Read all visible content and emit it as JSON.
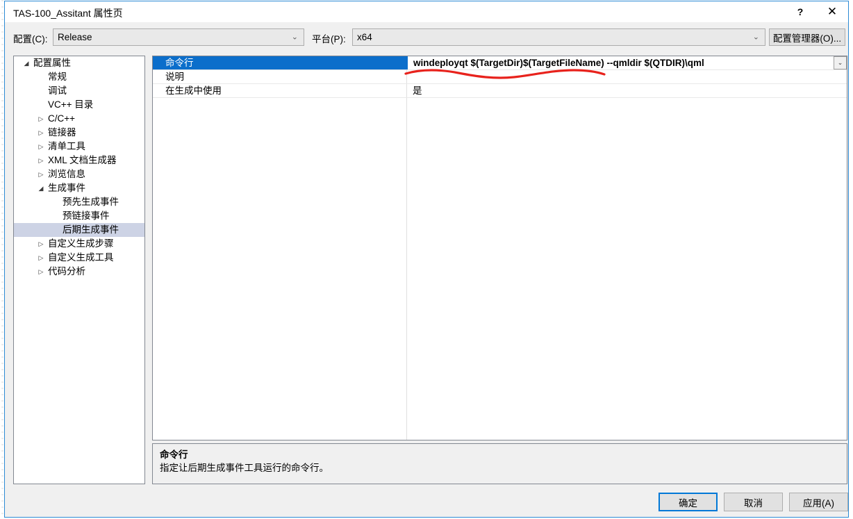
{
  "window": {
    "title": "TAS-100_Assitant 属性页",
    "help_icon": "question-mark-icon",
    "help_label": "?",
    "close_icon": "close-icon",
    "close_label": "✕",
    "accent_color": "#0078d7",
    "border_color": "#2b8ad4"
  },
  "configbar": {
    "config_label": "配置(C):",
    "config_value": "Release",
    "platform_label": "平台(P):",
    "platform_value": "x64",
    "config_manager_label": "配置管理器(O)...",
    "chevron_icon": "chevron-down-icon",
    "chevron_glyph": "⌄"
  },
  "tree": {
    "expanded_glyph": "◢",
    "collapsed_glyph": "▷",
    "items": [
      {
        "label": "配置属性",
        "indent": 0,
        "state": "expanded",
        "selected": false
      },
      {
        "label": "常规",
        "indent": 1,
        "state": "leaf",
        "selected": false
      },
      {
        "label": "调试",
        "indent": 1,
        "state": "leaf",
        "selected": false
      },
      {
        "label": "VC++ 目录",
        "indent": 1,
        "state": "leaf",
        "selected": false
      },
      {
        "label": "C/C++",
        "indent": 1,
        "state": "collapsed",
        "selected": false
      },
      {
        "label": "链接器",
        "indent": 1,
        "state": "collapsed",
        "selected": false
      },
      {
        "label": "清单工具",
        "indent": 1,
        "state": "collapsed",
        "selected": false
      },
      {
        "label": "XML 文档生成器",
        "indent": 1,
        "state": "collapsed",
        "selected": false
      },
      {
        "label": "浏览信息",
        "indent": 1,
        "state": "collapsed",
        "selected": false
      },
      {
        "label": "生成事件",
        "indent": 1,
        "state": "expanded",
        "selected": false
      },
      {
        "label": "预先生成事件",
        "indent": 2,
        "state": "leaf",
        "selected": false
      },
      {
        "label": "预链接事件",
        "indent": 2,
        "state": "leaf",
        "selected": false
      },
      {
        "label": "后期生成事件",
        "indent": 2,
        "state": "leaf",
        "selected": true
      },
      {
        "label": "自定义生成步骤",
        "indent": 1,
        "state": "collapsed",
        "selected": false
      },
      {
        "label": "自定义生成工具",
        "indent": 1,
        "state": "collapsed",
        "selected": false
      },
      {
        "label": "代码分析",
        "indent": 1,
        "state": "collapsed",
        "selected": false
      }
    ]
  },
  "grid": {
    "dropdown_icon": "chevron-down-icon",
    "dropdown_glyph": "⌄",
    "rows": [
      {
        "name": "命令行",
        "value": "windeployqt $(TargetDir)$(TargetFileName) --qmldir $(QTDIR)\\qml",
        "selected": true,
        "has_dropdown": true
      },
      {
        "name": "说明",
        "value": "",
        "selected": false,
        "has_dropdown": false
      },
      {
        "name": "在生成中使用",
        "value": "是",
        "selected": false,
        "has_dropdown": false
      }
    ]
  },
  "annotation": {
    "type": "red-squiggly-underline",
    "color": "#e8221c"
  },
  "description": {
    "title": "命令行",
    "body": "指定让后期生成事件工具运行的命令行。"
  },
  "footer": {
    "ok_label": "确定",
    "cancel_label": "取消",
    "apply_label": "应用(A)"
  }
}
